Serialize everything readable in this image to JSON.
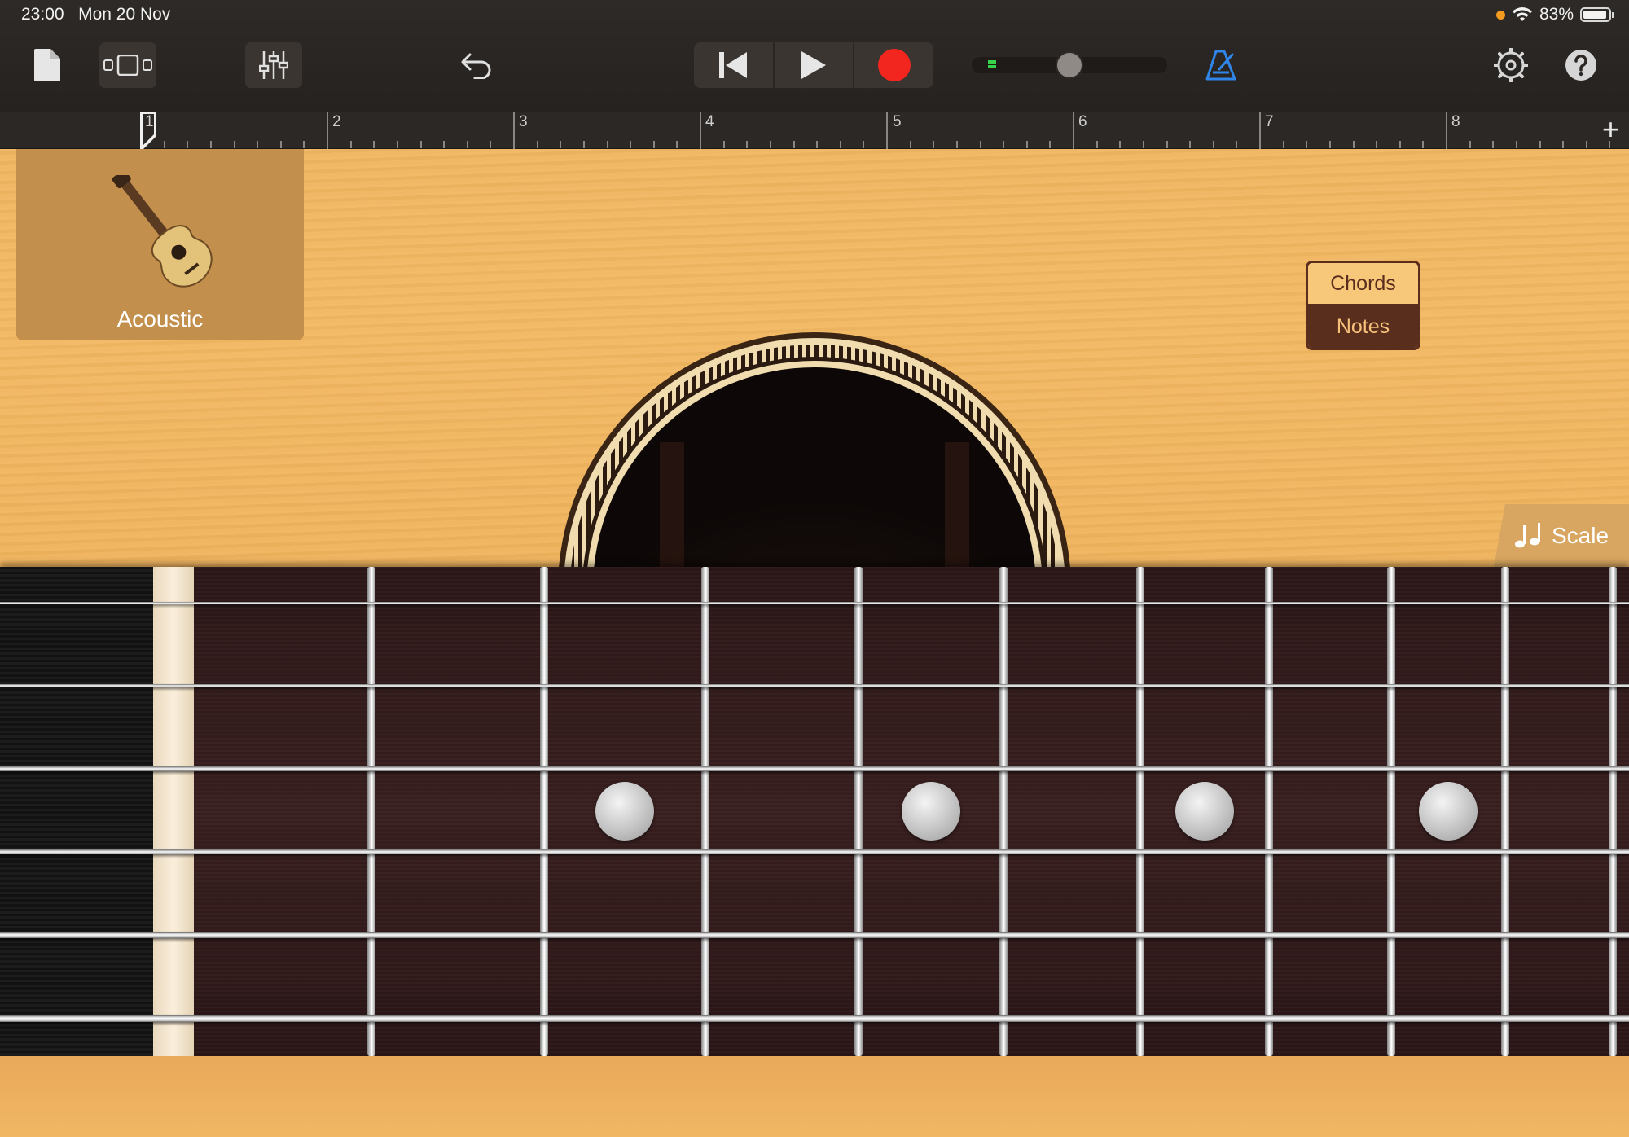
{
  "status_bar": {
    "time": "23:00",
    "date": "Mon 20 Nov",
    "battery": "83%",
    "battery_level": 0.83,
    "recording_indicator_color": "#f39a1f"
  },
  "toolbar": {
    "icons": [
      "document-icon",
      "track-view-icon",
      "mixer-icon",
      "undo-icon",
      "rewind-icon",
      "play-icon",
      "record-icon",
      "metronome-icon",
      "settings-icon",
      "help-icon"
    ],
    "accent_color": "#2f86e8",
    "record_color": "#f2261f",
    "master_volume": 0.5
  },
  "ruler": {
    "bars": [
      "1",
      "2",
      "3",
      "4",
      "5",
      "6",
      "7",
      "8"
    ],
    "add_label": "+"
  },
  "instrument": {
    "name": "Acoustic"
  },
  "mode_toggle": {
    "options": [
      "Chords",
      "Notes"
    ],
    "selected": "Notes"
  },
  "scale_button": {
    "label": "Scale"
  },
  "fretboard": {
    "strings": 6,
    "frets": 9,
    "inlay_frets": [
      3,
      5,
      7,
      9
    ]
  }
}
